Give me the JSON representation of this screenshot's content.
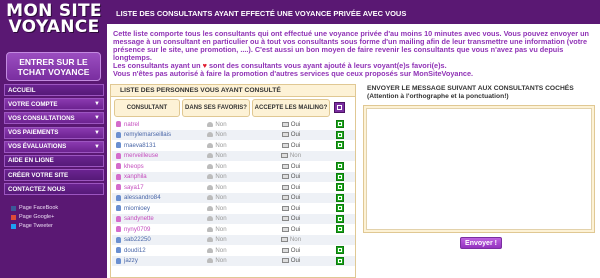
{
  "sidebar": {
    "logo_line1": "MON SITE",
    "logo_line2": "VOYANCE",
    "tchat_button": "ENTRER SUR LE TCHAT VOYANCE",
    "menu": [
      {
        "label": "Accueil",
        "has_arrow": false
      },
      {
        "label": "VOTRE COMPTE",
        "has_arrow": true
      },
      {
        "label": "VOS CONSULTATIONS",
        "has_arrow": true
      },
      {
        "label": "VOS PAIEMENTS",
        "has_arrow": true
      },
      {
        "label": "VOS ÉVALUATIONS",
        "has_arrow": true
      },
      {
        "label": "AIDE EN LIGNE",
        "has_arrow": false
      },
      {
        "label": "CRÉER VOTRE SITE",
        "has_arrow": false
      },
      {
        "label": "Contactez nous",
        "has_arrow": false
      }
    ],
    "social": [
      {
        "label": "Page FaceBook",
        "icon": "facebook-icon",
        "color": "#3b5998"
      },
      {
        "label": "Page Google+",
        "icon": "google-plus-icon",
        "color": "#dd4b39"
      },
      {
        "label": "Page Tweeter",
        "icon": "twitter-icon",
        "color": "#1da1f2"
      }
    ]
  },
  "main": {
    "title": "LISTE DES CONSULTANTS AYANT EFFECTÉ UNE VOYANCE PRIVÉE AVEC VOUS",
    "intro_line1": "Cette liste comporte tous les consultants qui ont effectué une voyance privée d'au moins 10 minutes avec vous. Vous pouvez envoyer un message à un consultant en particulier ou à tout vos consultants sous forme d'un mailing afin de leur transmettre une information (votre présence sur le site, une promotion, ....). C'est aussi un bon moyen de faire revenir les consultants que vous n'avez pas vu depuis longtemps.",
    "intro_line2_a": "Les consultants ayant un ",
    "intro_line2_b": " sont des consultants vous ayant ajouté à leurs voyant(e)s favori(e)s.",
    "intro_line3": "Vous n'êtes pas autorisé à faire la promotion d'autres services que ceux proposés sur MonSiteVoyance.",
    "heart": "♥"
  },
  "left_panel": {
    "title": "LISTE DES PERSONNES VOUS AYANT CONSULTÉ",
    "col_consultant": "CONSULTANT",
    "col_favoris": "DANS SES FAVORIS?",
    "col_mailing": "ACCEPTE LES MAILING?",
    "rows": [
      {
        "name": "natrel",
        "female": true,
        "fav": "Non",
        "mail": "Oui"
      },
      {
        "name": "remylemarseillais",
        "female": false,
        "fav": "Non",
        "mail": "Oui"
      },
      {
        "name": "maeva8131",
        "female": false,
        "fav": "Non",
        "mail": "Oui"
      },
      {
        "name": "merveilleuse",
        "female": true,
        "fav": "Non",
        "mail": "Non"
      },
      {
        "name": "kheops",
        "female": true,
        "fav": "Non",
        "mail": "Oui"
      },
      {
        "name": "xanphila",
        "female": true,
        "fav": "Non",
        "mail": "Oui"
      },
      {
        "name": "saya17",
        "female": true,
        "fav": "Non",
        "mail": "Oui"
      },
      {
        "name": "alessandro84",
        "female": false,
        "fav": "Non",
        "mail": "Oui"
      },
      {
        "name": "miomioey",
        "female": false,
        "fav": "Non",
        "mail": "Oui"
      },
      {
        "name": "sandynette",
        "female": true,
        "fav": "Non",
        "mail": "Oui"
      },
      {
        "name": "nyny0709",
        "female": true,
        "fav": "Non",
        "mail": "Oui"
      },
      {
        "name": "sab22250",
        "female": false,
        "fav": "Non",
        "mail": "Non"
      },
      {
        "name": "doudi12",
        "female": false,
        "fav": "Non",
        "mail": "Oui"
      },
      {
        "name": "jazzy",
        "female": false,
        "fav": "Non",
        "mail": "Oui"
      }
    ]
  },
  "right_panel": {
    "title": "ENVOYER LE MESSAGE SUIVANT AUX CONSULTANTS COCHÉS",
    "subtitle": "(Attention à l'orthographe et la ponctuation!)",
    "send_label": "Envoyer !",
    "message_value": ""
  },
  "colors": {
    "brand_purple": "#5a1873",
    "text_purple": "#9033b6",
    "check_green": "#1ea81e",
    "heart_red": "#e0192c"
  }
}
